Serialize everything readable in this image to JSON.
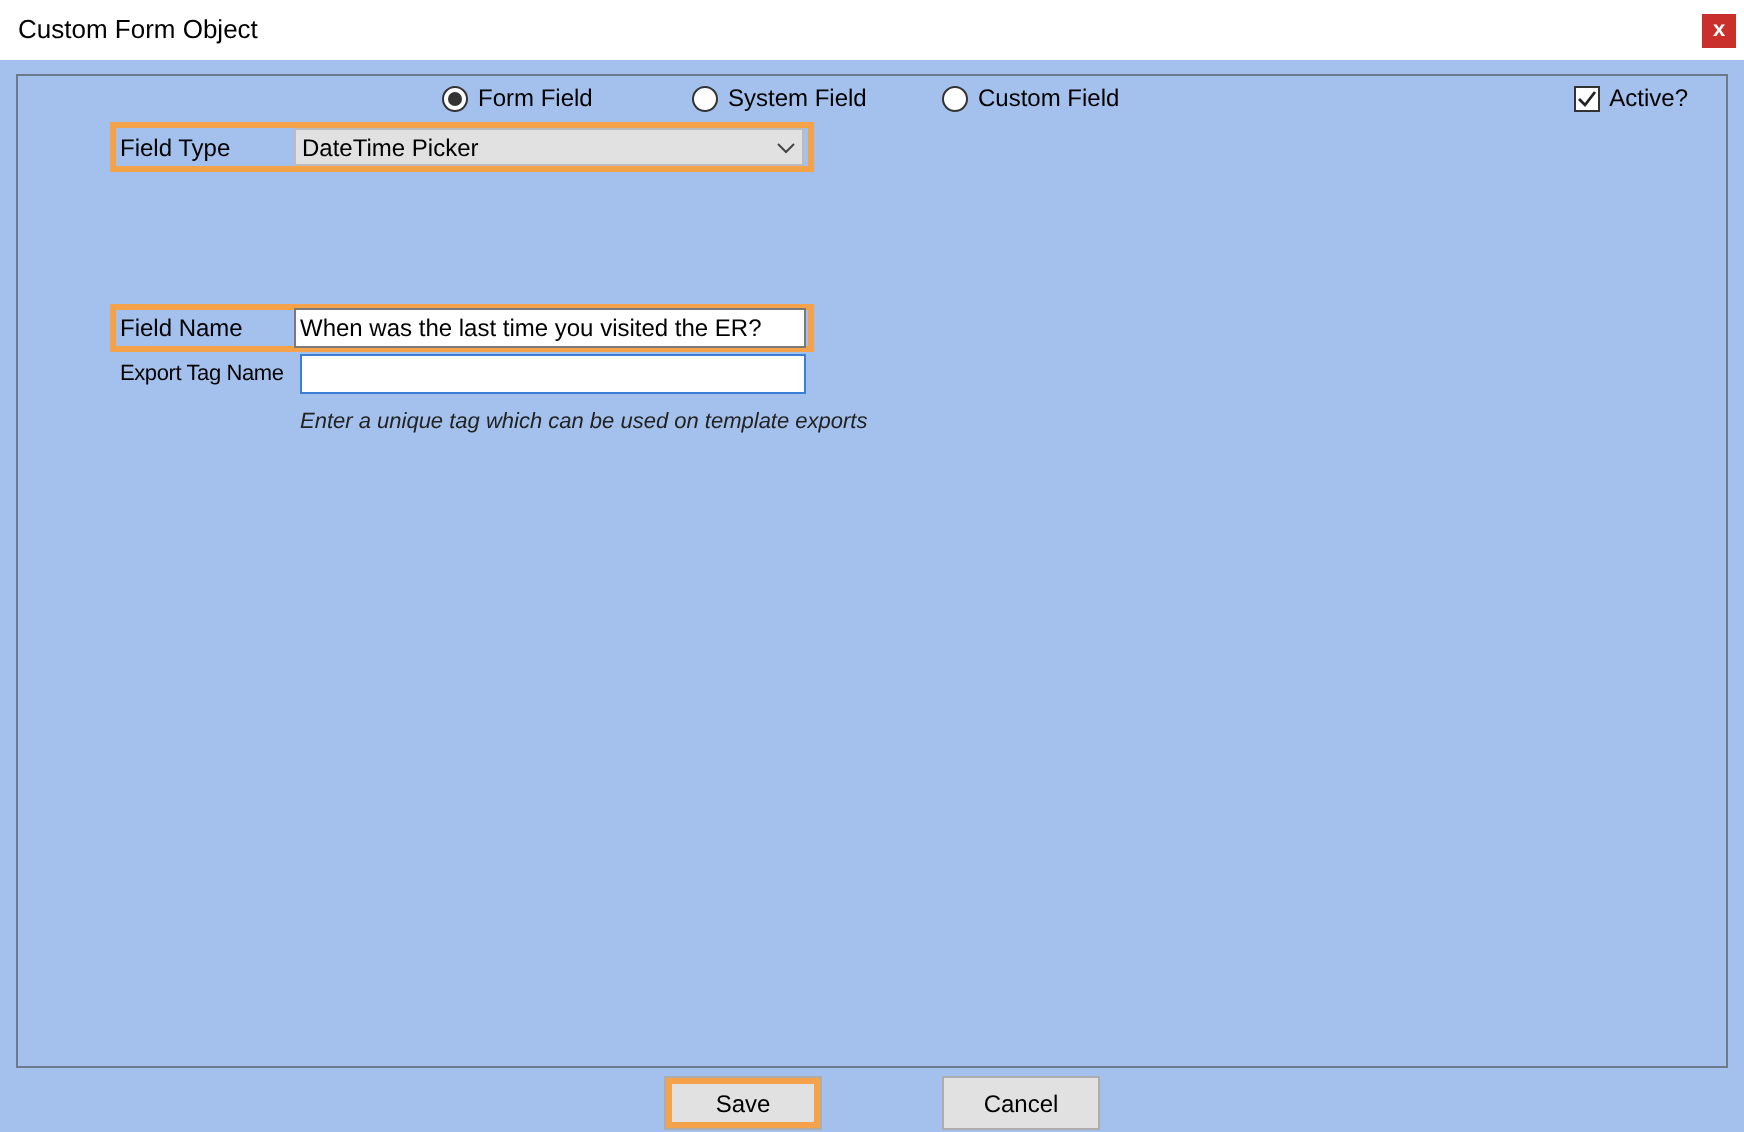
{
  "window": {
    "title": "Custom Form Object",
    "close": "x"
  },
  "source_options": [
    {
      "label": "Form Field",
      "selected": true
    },
    {
      "label": "System Field",
      "selected": false
    },
    {
      "label": "Custom Field",
      "selected": false
    }
  ],
  "active": {
    "label": "Active?",
    "checked": true
  },
  "field_type": {
    "label": "Field Type",
    "value": "DateTime Picker",
    "highlighted": true
  },
  "field_name": {
    "label": "Field Name",
    "value": "When was the last time you visited the ER?",
    "highlighted": true
  },
  "export_tag": {
    "label": "Export Tag Name",
    "hint": "Enter a unique tag which can be used on template exports",
    "highlighted": false
  },
  "buttons": [
    {
      "label": "Save",
      "highlighted": true
    },
    {
      "label": "Cancel",
      "highlighted": false
    }
  ]
}
